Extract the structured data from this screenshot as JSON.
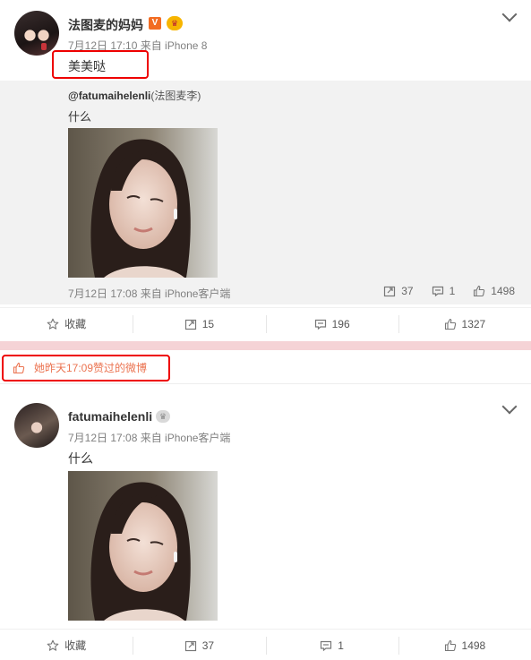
{
  "post1": {
    "username": "法图麦的妈妈",
    "meta": "7月12日 17:10 来自 iPhone 8",
    "text": "美美哒",
    "repost": {
      "author": "@fatumaihelenli",
      "author_suffix": "(法图麦李)",
      "text": "什么",
      "meta": "7月12日 17:08 来自 iPhone客户端",
      "stats": {
        "reposts": "37",
        "comments": "1",
        "likes": "1498"
      }
    },
    "actions": {
      "favorite": "收藏",
      "reposts": "15",
      "comments": "196",
      "likes": "1327"
    }
  },
  "liked_banner": {
    "text": "她昨天17:09赞过的微博"
  },
  "post2": {
    "username": "fatumaihelenli",
    "meta": "7月12日 17:08 来自 iPhone客户端",
    "text": "什么",
    "actions": {
      "favorite": "收藏",
      "reposts": "37",
      "comments": "1",
      "likes": "1498"
    }
  },
  "colors": {
    "accent": "#eb7350",
    "highlight_box": "#ee0000",
    "divider": "#f5d3d6",
    "repost_bg": "#f2f2f2"
  },
  "icons": [
    "star-icon",
    "repost-icon",
    "comment-icon",
    "thumbs-up-icon",
    "chevron-down-icon",
    "verified-v-icon",
    "crown-icon"
  ]
}
